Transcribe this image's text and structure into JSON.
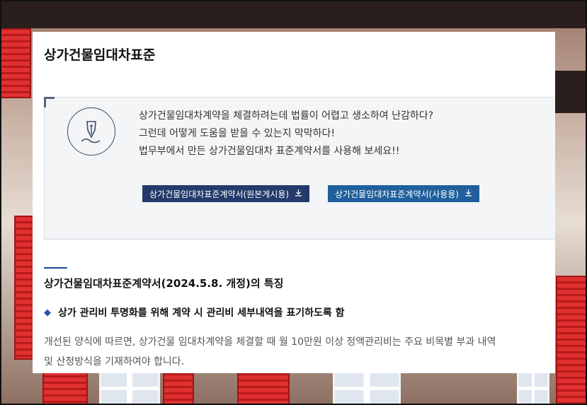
{
  "page_title": "상가건물임대차표준",
  "intro": {
    "line1": "상가건물임대차계약을 체결하려는데 법률이 어렵고 생소하여 난감하다?",
    "line2": "그런데 어떻게 도움을 받을 수 있는지 막막하다!",
    "line3": "법무부에서 만든 상가건물임대차 표준계약서를 사용해 보세요!!"
  },
  "buttons": {
    "original": "상가건물임대차표준계약서(원본게시용)",
    "usage": "상가건물임대차표준계약서(사용용)"
  },
  "section": {
    "title": "상가건물임대차표준계약서(2024.5.8. 개정)의 특징",
    "bullet": "상가 관리비 투명화를 위해 계약 시 관리비 세부내역을 표기하도록 함",
    "para_line1": "개선된 양식에 따르면, 상가건물 임대차계약을 체결할 때 월 10만원 이상 정액관리비는 주요 비목별 부과 내역",
    "para_line2": "및 산정방식을 기재하여야 합니다."
  },
  "icons": {
    "pen": "fountain-pen-icon",
    "download": "download-icon"
  },
  "colors": {
    "button_dark": "#243a6b",
    "button_blue": "#1f5f9c",
    "accent": "#1f4a8a"
  }
}
